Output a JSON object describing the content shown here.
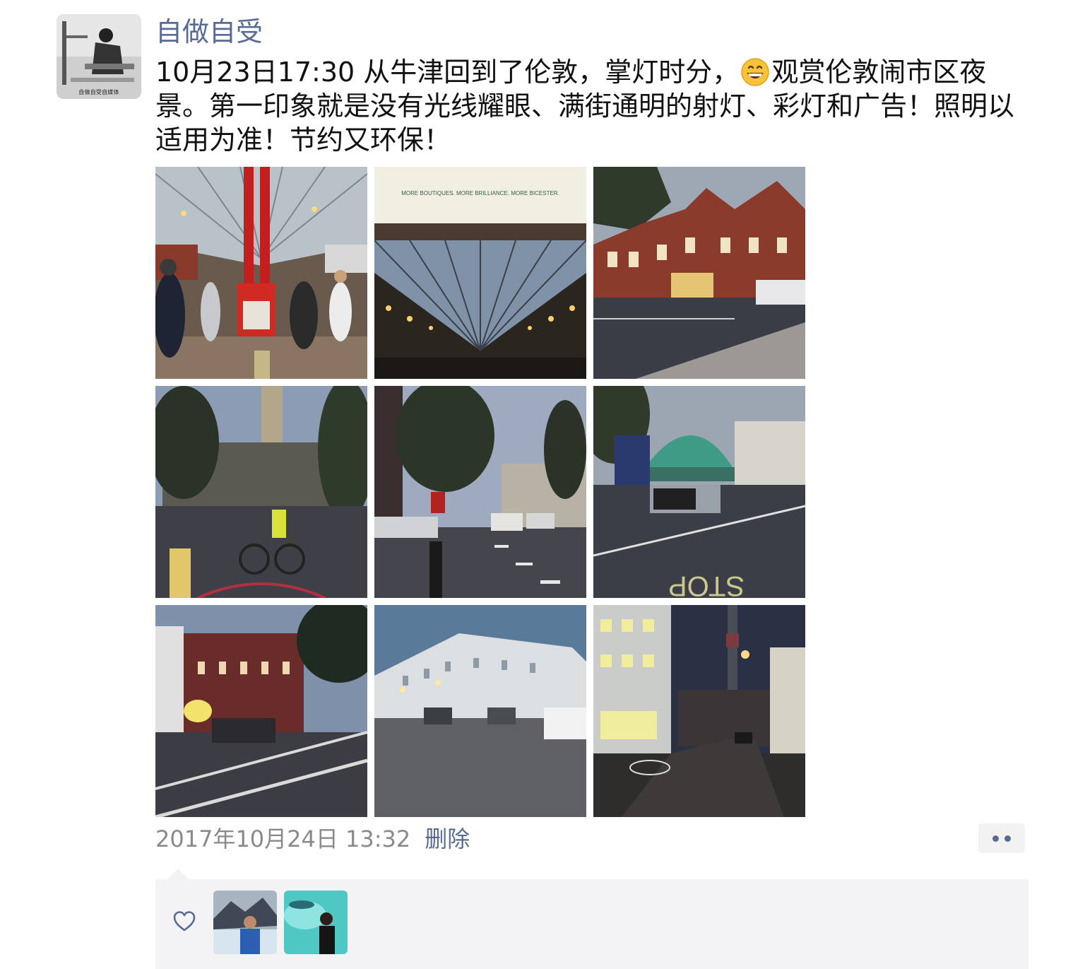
{
  "post": {
    "author": "自做自受",
    "avatar_caption": "自做自受自媒体",
    "text_before_emoji": "10月23日17:30 从牛津回到了伦敦，掌灯时分，",
    "emoji": "grinning-face",
    "text_after_emoji": "观赏伦敦闹市区夜景。第一印象就是没有光线耀眼、满街通明的射灯、彩灯和广告！照明以适用为准！节约又环保！",
    "photos": [
      {
        "name": "photo-train-platform",
        "subject": "train-station-platform"
      },
      {
        "name": "photo-station-roof",
        "subject": "station-roof-billboard"
      },
      {
        "name": "photo-station-building",
        "subject": "red-brick-station"
      },
      {
        "name": "photo-cyclist-street",
        "subject": "church-street-cyclist"
      },
      {
        "name": "photo-busy-street",
        "subject": "street-traffic-bus"
      },
      {
        "name": "photo-green-dome",
        "subject": "green-dome-road"
      },
      {
        "name": "photo-red-building",
        "subject": "red-building-street"
      },
      {
        "name": "photo-white-terrace",
        "subject": "white-terrace-road"
      },
      {
        "name": "photo-tower-night",
        "subject": "night-street-tower"
      }
    ],
    "billboard_text": "MORE BOUTIQUES. MORE BRILLIANCE. MORE BICESTER.",
    "timestamp": "2017年10月24日 13:32",
    "delete_label": "删除"
  },
  "likes": {
    "icon": "heart-outline-icon",
    "count": 2
  },
  "colors": {
    "link": "#576b95",
    "meta": "#8a8a8a",
    "panel": "#f3f3f5"
  }
}
